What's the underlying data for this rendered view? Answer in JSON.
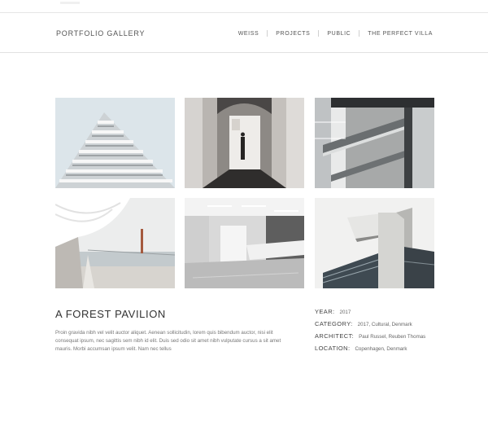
{
  "header": {
    "brand": "PORTFOLIO GALLERY",
    "nav": [
      {
        "label": "WEISS"
      },
      {
        "label": "PROJECTS"
      },
      {
        "label": "PUBLIC"
      },
      {
        "label": "THE PERFECT VILLA"
      }
    ]
  },
  "gallery": {
    "images": [
      {
        "subject": "stepped white tower"
      },
      {
        "subject": "gallery hall with figure"
      },
      {
        "subject": "concrete staircase"
      },
      {
        "subject": "curved pavilion by the bridge"
      },
      {
        "subject": "white interior lobby"
      },
      {
        "subject": "cantilevered building corner"
      }
    ]
  },
  "project": {
    "title": "A FOREST PAVILION",
    "description": "Proin gravida nibh vel velit auctor aliquet. Aenean sollicitudin, lorem quis bibendum auctor, nisi elit consequat ipsum, nec sagittis sem nibh id elit. Duis sed odio sit amet nibh vulputate cursus a sit amet mauris. Morbi accumsan ipsum velit. Nam nec tellus",
    "details": [
      {
        "label": "YEAR:",
        "value": "2017"
      },
      {
        "label": "CATEGORY:",
        "value": "2017, Cultural, Denmark"
      },
      {
        "label": "ARCHITECT:",
        "value": "Paul Russel, Reuben Thomas"
      },
      {
        "label": "LOCATION:",
        "value": "Copenhagen, Denmark"
      }
    ]
  }
}
